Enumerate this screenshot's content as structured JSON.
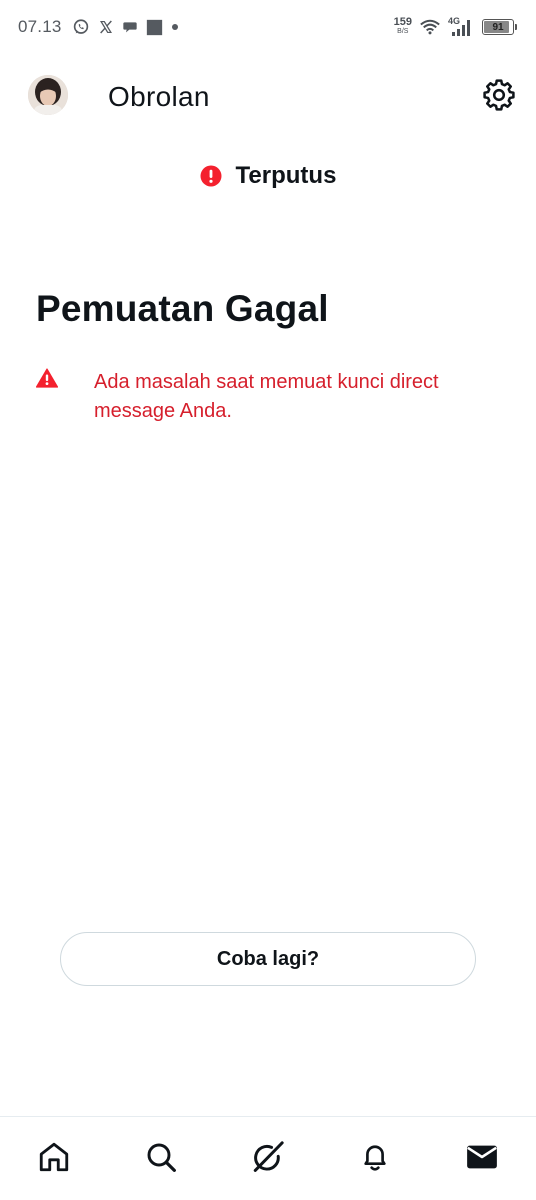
{
  "status_bar": {
    "time": "07.13",
    "net_speed_value": "159",
    "net_speed_unit": "B/S",
    "network_type": "4G",
    "battery_level": "91",
    "battery_fraction": 0.91,
    "notification_icons": [
      "whatsapp-icon",
      "x-logo-icon",
      "chat-bubble-icon",
      "square-app-icon",
      "dot-icon"
    ]
  },
  "header": {
    "title": "Obrolan",
    "settings_icon": "gear-icon"
  },
  "connection": {
    "status_label": "Terputus",
    "status_icon": "error-circle-icon",
    "status_color": "#f4212e"
  },
  "error": {
    "title": "Pemuatan Gagal",
    "message": "Ada masalah saat memuat kunci direct message Anda.",
    "icon": "warning-triangle-icon",
    "color": "#d61f2c"
  },
  "retry": {
    "label": "Coba lagi?"
  },
  "bottom_nav": {
    "items": [
      {
        "name": "home",
        "icon": "home-icon"
      },
      {
        "name": "search",
        "icon": "search-icon"
      },
      {
        "name": "grok",
        "icon": "grok-icon"
      },
      {
        "name": "notifications",
        "icon": "bell-icon"
      },
      {
        "name": "messages",
        "icon": "mail-icon",
        "active": true
      }
    ]
  },
  "colors": {
    "text_primary": "#0f1419",
    "error_red": "#d61f2c",
    "border": "#cfd9de"
  }
}
